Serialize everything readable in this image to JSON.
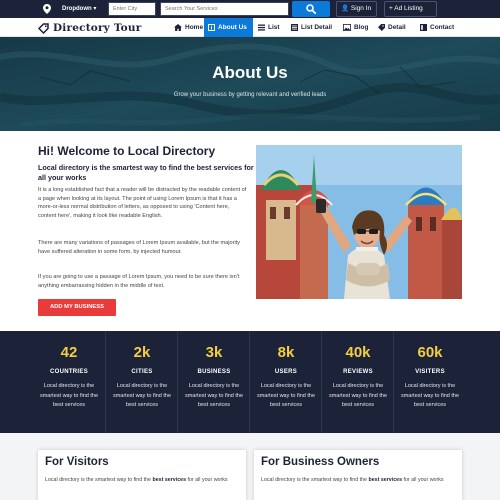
{
  "topbar": {
    "dropdown_label": "Dropdown",
    "city_placeholder": "Enter City",
    "search_placeholder": "Search Your Services",
    "signin_label": "Sign In",
    "add_listing_label": "Ad Listing"
  },
  "logo": {
    "text": "Directory Tour"
  },
  "nav": {
    "items": [
      {
        "label": "Home",
        "icon": "home-icon"
      },
      {
        "label": "About Us",
        "icon": "info-icon",
        "active": true
      },
      {
        "label": "List",
        "icon": "list-icon"
      },
      {
        "label": "List Detail",
        "icon": "list-detail-icon"
      },
      {
        "label": "Blog",
        "icon": "blog-icon"
      },
      {
        "label": "Detail",
        "icon": "detail-icon"
      },
      {
        "label": "Contact",
        "icon": "contact-icon"
      }
    ]
  },
  "hero": {
    "title": "About Us",
    "subtitle": "Grow your business by getting relevant and verified leads"
  },
  "welcome": {
    "title": "Hi! Welcome to Local Directory",
    "lead": "Local directory is the smartest way to find the best services for all your works",
    "paragraphs": [
      "It is a long established fact that a reader will be distracted by the readable content of a page when looking at its layout. The point of using Lorem Ipsum is that it has a more-or-less normal distribution of letters, as opposed to using 'Content here, content here', making it look like readable English.",
      "There are many variations of passages of Lorem Ipsum available, but the majority have suffered alteration in some form, by injected humour.",
      "If you are going to use a passage of Lorem Ipsum, you need to be sure there isn't anything embarrassing hidden in the middle of text."
    ],
    "cta_label": "ADD MY BUSINESS"
  },
  "stats": {
    "items": [
      {
        "number": "42",
        "label": "COUNTRIES",
        "desc": "Local directory is the smartest way to find the best services"
      },
      {
        "number": "2k",
        "label": "CITIES",
        "desc": "Local directory is the smartest way to find the best services"
      },
      {
        "number": "3k",
        "label": "BUSINESS",
        "desc": "Local directory is the smartest way to find the best services"
      },
      {
        "number": "8k",
        "label": "USERS",
        "desc": "Local directory is the smartest way to find the best services"
      },
      {
        "number": "40k",
        "label": "REVIEWS",
        "desc": "Local directory is the smartest way to find the best services"
      },
      {
        "number": "60k",
        "label": "VISITERS",
        "desc": "Local directory is the smartest way to find the best services"
      }
    ]
  },
  "cards": [
    {
      "title": "For Visitors",
      "text_before": "Local directory is the smartest way to find the ",
      "text_bold": "best services",
      "text_after": " for all your works"
    },
    {
      "title": "For Business Owners",
      "text_before": "Local directory is the smartest way to find the ",
      "text_bold": "best services",
      "text_after": " for all your works"
    }
  ],
  "colors": {
    "navy": "#1c2237",
    "accent_blue": "#0b7ad8",
    "cta_red": "#ea3b3b",
    "stat_yellow": "#f4d03f"
  }
}
